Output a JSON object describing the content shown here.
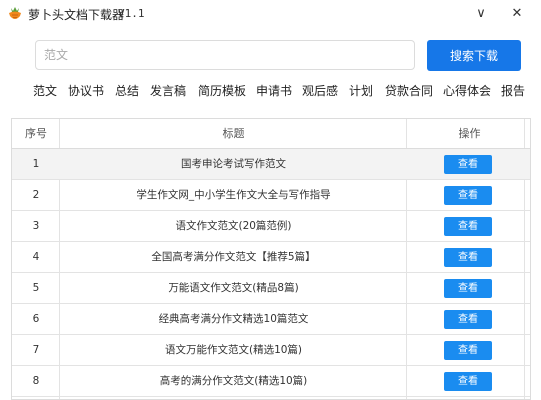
{
  "app": {
    "title": "萝卜头文档下载器",
    "version": "V1.1",
    "minimize_label": "∨",
    "close_label": "✕",
    "accent_color": "#1677e8"
  },
  "search": {
    "placeholder": "范文",
    "value": "",
    "button_label": "搜索下载"
  },
  "categories": [
    "范文",
    "协议书",
    "总结",
    "发言稿",
    "简历模板",
    "申请书",
    "观后感",
    "计划",
    "贷款合同",
    "心得体会",
    "报告"
  ],
  "table": {
    "headers": [
      "序号",
      "标题",
      "操作"
    ],
    "rows": [
      {
        "index": "1",
        "title": "国考申论考试写作范文",
        "action": "查看"
      },
      {
        "index": "2",
        "title": "学生作文网_中小学生作文大全与写作指导",
        "action": "查看"
      },
      {
        "index": "3",
        "title": "语文作文范文(20篇范例)",
        "action": "查看"
      },
      {
        "index": "4",
        "title": "全国高考满分作文范文【推荐5篇】",
        "action": "查看"
      },
      {
        "index": "5",
        "title": "万能语文作文范文(精品8篇)",
        "action": "查看"
      },
      {
        "index": "6",
        "title": "经典高考满分作文精选10篇范文",
        "action": "查看"
      },
      {
        "index": "7",
        "title": "语文万能作文范文(精选10篇)",
        "action": "查看"
      },
      {
        "index": "8",
        "title": "高考的满分作文范文(精选10篇)",
        "action": "查看"
      }
    ]
  }
}
